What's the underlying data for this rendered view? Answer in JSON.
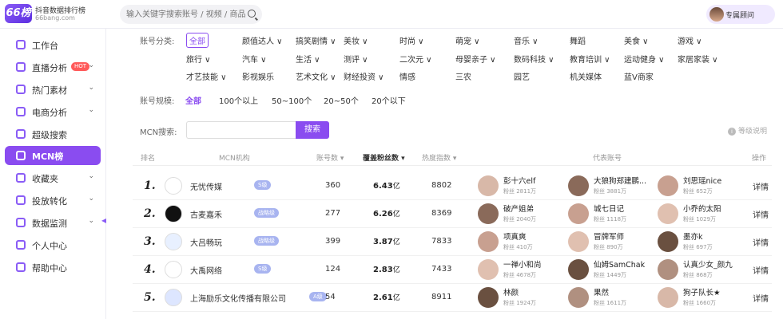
{
  "header": {
    "logo_mark": "66榜",
    "logo_title": "抖音数据排行榜",
    "logo_domain": "66bang.com",
    "search_placeholder": "输入关键字搜索账号 / 视频 / 商品",
    "consult_label": "专属顾问"
  },
  "sidebar": {
    "items": [
      {
        "label": "工作台",
        "chevron": false
      },
      {
        "label": "直播分析",
        "chevron": true,
        "badge": "HOT"
      },
      {
        "label": "热门素材",
        "chevron": true
      },
      {
        "label": "电商分析",
        "chevron": true
      },
      {
        "label": "超级搜索",
        "chevron": false
      },
      {
        "label": "MCN榜",
        "chevron": false,
        "active": true
      },
      {
        "label": "收藏夹",
        "chevron": true
      },
      {
        "label": "投放转化",
        "chevron": true
      },
      {
        "label": "数据监测",
        "chevron": true
      },
      {
        "label": "个人中心",
        "chevron": false
      },
      {
        "label": "帮助中心",
        "chevron": false
      }
    ],
    "chevron_glyph": "⌄",
    "collapse_glyph": "◀"
  },
  "filters": {
    "category_label": "账号分类:",
    "categories_row1": [
      "全部",
      "颜值达人 ∨",
      "搞笑剧情 ∨",
      "美妆 ∨",
      "时尚 ∨",
      "萌宠 ∨",
      "音乐 ∨",
      "舞蹈",
      "美食 ∨",
      "游戏 ∨"
    ],
    "categories_row2": [
      "旅行 ∨",
      "汽车 ∨",
      "生活 ∨",
      "测评 ∨",
      "二次元 ∨",
      "母婴亲子 ∨",
      "数码科技 ∨",
      "教育培训 ∨",
      "运动健身 ∨",
      "家居家装 ∨"
    ],
    "categories_row3": [
      "才艺技能 ∨",
      "影视娱乐",
      "艺术文化 ∨",
      "财经投资 ∨",
      "情感",
      "三农",
      "园艺",
      "机关媒体",
      "蓝V商家"
    ],
    "scale_label": "账号规模:",
    "scales": [
      "全部",
      "100个以上",
      "50~100个",
      "20~50个",
      "20个以下"
    ],
    "mcn_label": "MCN搜索:",
    "mcn_input_value": "",
    "mcn_button": "搜索",
    "level_note": "等级说明",
    "info_glyph": "i"
  },
  "table": {
    "headers": {
      "rank": "排名",
      "org": "MCN机构",
      "accounts": "账号数 ▾",
      "fans": "覆盖粉丝数 ▾",
      "heat": "热度指数 ▾",
      "reps": "代表账号",
      "action": "操作"
    },
    "rows": [
      {
        "rank": "1.",
        "org": "无忧传媒",
        "level": "S级",
        "logo_color": "#ffffff",
        "accounts": "360",
        "fans": "6.43",
        "fans_unit": "亿",
        "heat": "8802",
        "detail": "详情",
        "reps": [
          {
            "name": "彭十六elf",
            "fans": "粉丝 2811万"
          },
          {
            "name": "大狼狗郑建鹏...",
            "fans": "粉丝 3881万"
          },
          {
            "name": "刘思瑶nice",
            "fans": "粉丝 652万"
          }
        ]
      },
      {
        "rank": "2.",
        "org": "古麦嘉禾",
        "level": "战略级",
        "logo_color": "#111111",
        "accounts": "277",
        "fans": "6.26",
        "fans_unit": "亿",
        "heat": "8369",
        "detail": "详情",
        "reps": [
          {
            "name": "破产姐弟",
            "fans": "粉丝 2040万"
          },
          {
            "name": "城七日记",
            "fans": "粉丝 1118万"
          },
          {
            "name": "小乔的太阳",
            "fans": "粉丝 1029万"
          }
        ]
      },
      {
        "rank": "3.",
        "org": "大吕畅玩",
        "level": "战略级",
        "logo_color": "#e8f0ff",
        "accounts": "399",
        "fans": "3.87",
        "fans_unit": "亿",
        "heat": "7833",
        "detail": "详情",
        "reps": [
          {
            "name": "项真爽",
            "fans": "粉丝 410万"
          },
          {
            "name": "冒牌军师",
            "fans": "粉丝 890万"
          },
          {
            "name": "墨亦k",
            "fans": "粉丝 697万"
          }
        ]
      },
      {
        "rank": "4.",
        "org": "大禹网络",
        "level": "S级",
        "logo_color": "#ffffff",
        "accounts": "124",
        "fans": "2.83",
        "fans_unit": "亿",
        "heat": "7433",
        "detail": "详情",
        "reps": [
          {
            "name": "一禅小和尚",
            "fans": "粉丝 4678万"
          },
          {
            "name": "仙姆SamChak",
            "fans": "粉丝 1449万"
          },
          {
            "name": "认真少女_颜九",
            "fans": "粉丝 868万"
          }
        ]
      },
      {
        "rank": "5.",
        "org": "上海励乐文化传播有限公司",
        "level": "A级",
        "logo_color": "#dde6ff",
        "accounts": "54",
        "fans": "2.61",
        "fans_unit": "亿",
        "heat": "8911",
        "detail": "详情",
        "reps": [
          {
            "name": "林颜",
            "fans": "粉丝 1924万"
          },
          {
            "name": "果然",
            "fans": "粉丝 1611万"
          },
          {
            "name": "狗子队长★",
            "fans": "粉丝 1660万"
          }
        ]
      }
    ]
  }
}
